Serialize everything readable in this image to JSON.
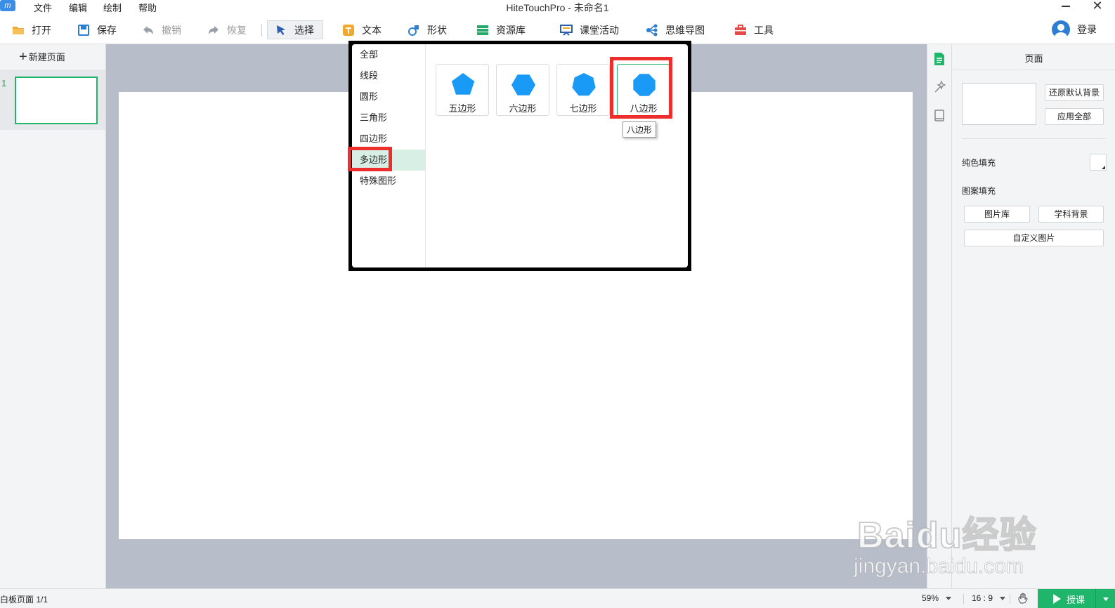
{
  "app": {
    "window_title": "HiteTouchPro - 未命名1",
    "menu": [
      "文件",
      "编辑",
      "绘制",
      "帮助"
    ]
  },
  "toolbar": {
    "open": "打开",
    "save": "保存",
    "undo": "撤销",
    "redo": "恢复",
    "select": "选择",
    "text": "文本",
    "shape": "形状",
    "resources": "资源库",
    "class_activity": "课堂活动",
    "mind_map": "思维导图",
    "tools": "工具",
    "login": "登录"
  },
  "left_panel": {
    "new_page": "新建页面",
    "pages": [
      {
        "number": "1"
      }
    ]
  },
  "shape_popup": {
    "categories": [
      "全部",
      "线段",
      "圆形",
      "三角形",
      "四边形",
      "多边形",
      "特殊图形"
    ],
    "active_category": "多边形",
    "shapes": [
      {
        "label": "五边形",
        "sides": 5
      },
      {
        "label": "六边形",
        "sides": 6
      },
      {
        "label": "七边形",
        "sides": 7
      },
      {
        "label": "八边形",
        "sides": 8
      }
    ],
    "shape_color": "#1a9af7",
    "tooltip": "八边形",
    "highlight_color": "#ee2d2d"
  },
  "right_panel": {
    "title": "页面",
    "restore_default_bg": "还原默认背景",
    "apply_all": "应用全部",
    "solid_fill": "纯色填充",
    "pattern_fill": "图案填充",
    "image_library": "图片库",
    "subject_bg": "学科背景",
    "custom_image": "自定义图片"
  },
  "statusbar": {
    "page_status": "白板页面 1/1",
    "zoom": "59%",
    "ratio": "16 : 9",
    "teach": "授课"
  },
  "watermark": {
    "brand": "Baidu经验",
    "url": "jingyan.baidu.com"
  },
  "colors": {
    "accent_green": "#1fb56a",
    "canvas_bg": "#b7bdc9"
  }
}
